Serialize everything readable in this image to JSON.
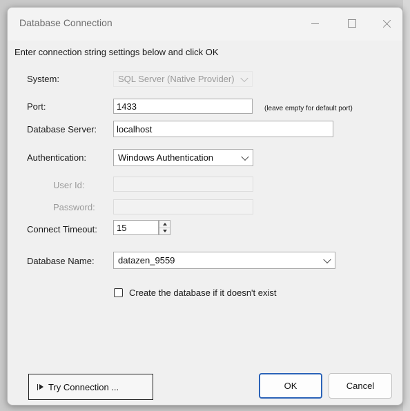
{
  "window": {
    "title": "Database Connection"
  },
  "instructions": "Enter connection string settings below and click OK",
  "form": {
    "system_label": "System:",
    "system_value": "SQL Server (Native Provider)",
    "port_label": "Port:",
    "port_value": "1433",
    "port_hint": "(leave empty for default port)",
    "server_label": "Database Server:",
    "server_value": "localhost",
    "auth_label": "Authentication:",
    "auth_value": "Windows Authentication",
    "userid_label": "User Id:",
    "userid_value": "",
    "password_label": "Password:",
    "password_value": "",
    "timeout_label": "Connect Timeout:",
    "timeout_value": "15",
    "dbname_label": "Database Name:",
    "dbname_value": "datazen_9559",
    "create_db_label": "Create the database if it doesn't exist",
    "create_db_checked": false
  },
  "buttons": {
    "try_connection": "Try Connection ...",
    "ok": "OK",
    "cancel": "Cancel"
  },
  "icons": {
    "minimize": "minimize-icon",
    "maximize": "maximize-icon",
    "close": "close-icon",
    "try": "play-icon"
  },
  "colors": {
    "window_bg": "#f0f0f0",
    "accent_border": "#2b63b8",
    "disabled_text": "#9a9a9a"
  }
}
